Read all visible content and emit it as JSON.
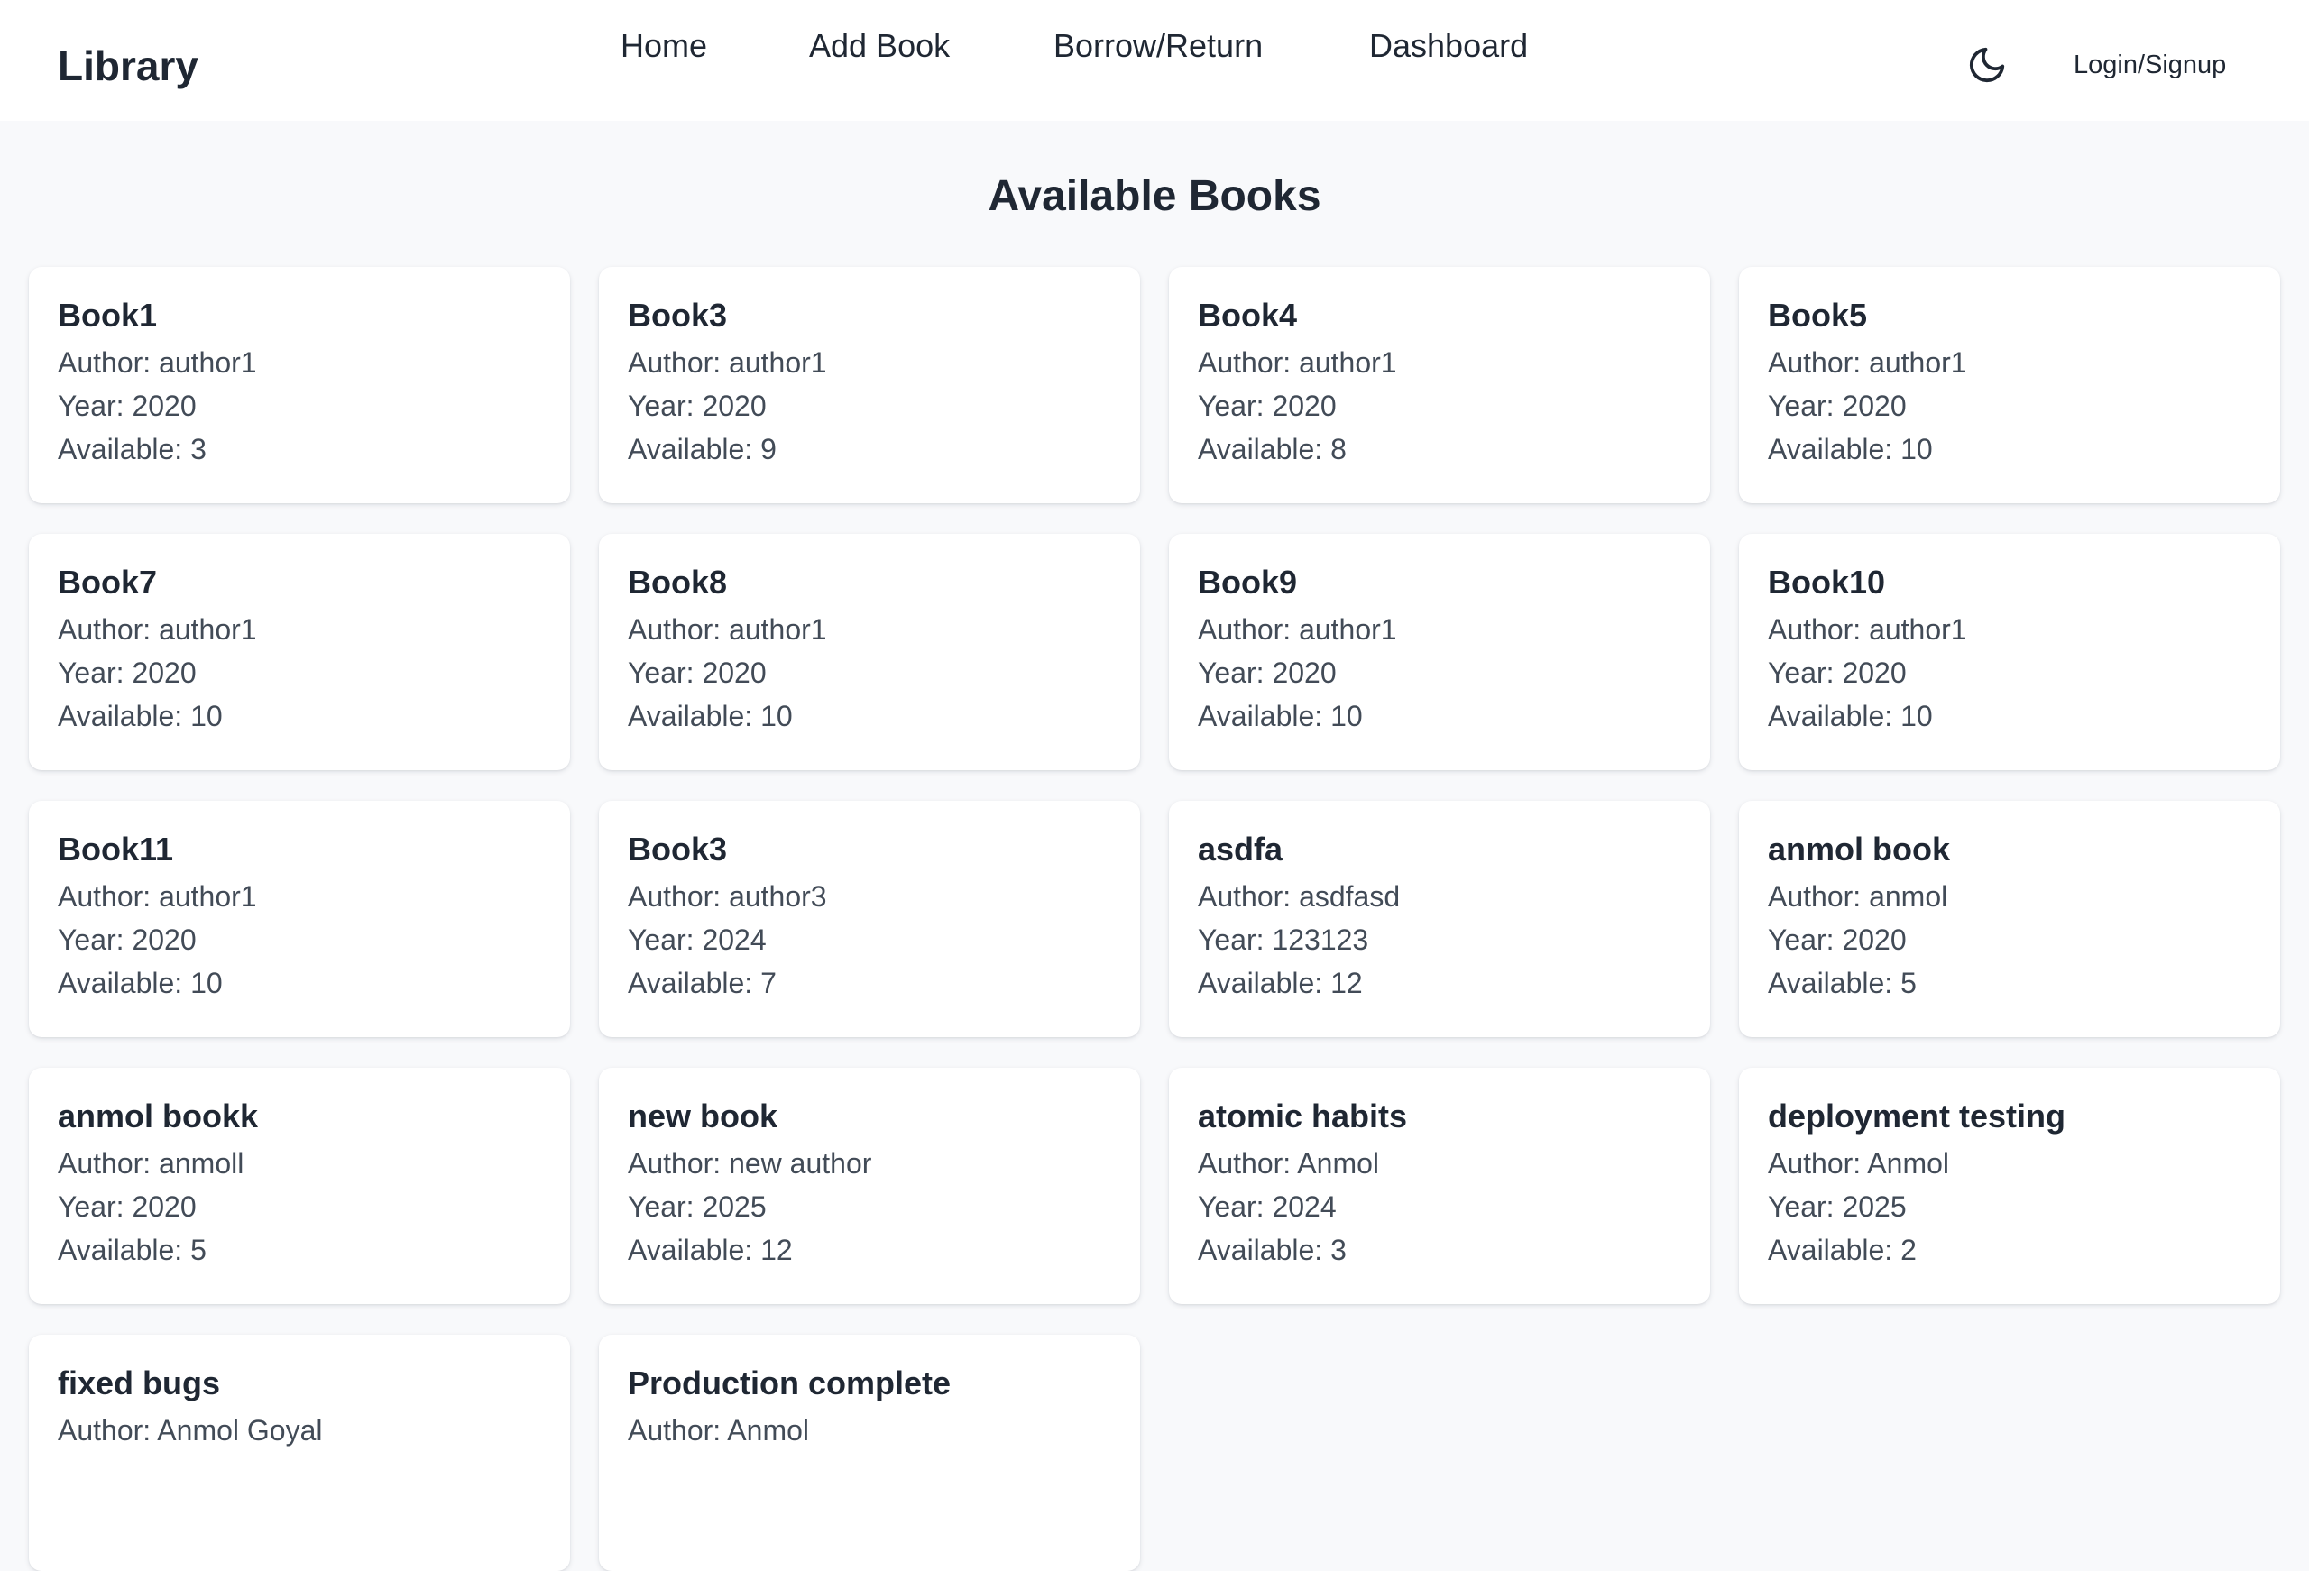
{
  "navbar": {
    "brand": "Library",
    "links": [
      {
        "label": "Home"
      },
      {
        "label": "Add Book"
      },
      {
        "label": "Borrow/Return"
      },
      {
        "label": "Dashboard"
      }
    ],
    "theme_icon": "moon-icon",
    "login_label": "Login/Signup"
  },
  "main": {
    "title": "Available Books",
    "author_prefix": "Author:",
    "year_prefix": "Year:",
    "available_prefix": "Available:",
    "books": [
      {
        "title": "Book1",
        "author": "author1",
        "year": "2020",
        "available": "3"
      },
      {
        "title": "Book3",
        "author": "author1",
        "year": "2020",
        "available": "9"
      },
      {
        "title": "Book4",
        "author": "author1",
        "year": "2020",
        "available": "8"
      },
      {
        "title": "Book5",
        "author": "author1",
        "year": "2020",
        "available": "10"
      },
      {
        "title": "Book7",
        "author": "author1",
        "year": "2020",
        "available": "10"
      },
      {
        "title": "Book8",
        "author": "author1",
        "year": "2020",
        "available": "10"
      },
      {
        "title": "Book9",
        "author": "author1",
        "year": "2020",
        "available": "10"
      },
      {
        "title": "Book10",
        "author": "author1",
        "year": "2020",
        "available": "10"
      },
      {
        "title": "Book11",
        "author": "author1",
        "year": "2020",
        "available": "10"
      },
      {
        "title": "Book3",
        "author": "author3",
        "year": "2024",
        "available": "7"
      },
      {
        "title": "asdfa",
        "author": "asdfasd",
        "year": "123123",
        "available": "12"
      },
      {
        "title": "anmol book",
        "author": "anmol",
        "year": "2020",
        "available": "5"
      },
      {
        "title": "anmol bookk",
        "author": "anmoll",
        "year": "2020",
        "available": "5"
      },
      {
        "title": "new book",
        "author": "new author",
        "year": "2025",
        "available": "12"
      },
      {
        "title": "atomic habits",
        "author": "Anmol",
        "year": "2024",
        "available": "3"
      },
      {
        "title": "deployment testing",
        "author": "Anmol",
        "year": "2025",
        "available": "2"
      },
      {
        "title": "fixed bugs",
        "author": "Anmol Goyal"
      },
      {
        "title": "Production complete",
        "author": "Anmol"
      }
    ]
  }
}
